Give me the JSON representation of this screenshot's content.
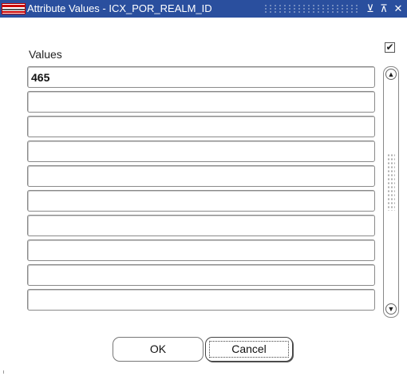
{
  "window": {
    "title": "Attribute Values - ICX_POR_REALM_ID",
    "minimize_glyph": "⊻",
    "maximize_glyph": "⊼",
    "close_glyph": "✕",
    "app_icon": "oracle-forms-icon"
  },
  "form": {
    "checkbox_checked": true,
    "checkbox_glyph": "✔",
    "values_label": "Values",
    "values": [
      "465",
      "",
      "",
      "",
      "",
      "",
      "",
      "",
      "",
      ""
    ]
  },
  "scrollbar": {
    "up_glyph": "▲",
    "down_glyph": "▼"
  },
  "buttons": {
    "ok_label": "OK",
    "cancel_label": "Cancel"
  },
  "colors": {
    "titlebar": "#2a4f9e"
  }
}
